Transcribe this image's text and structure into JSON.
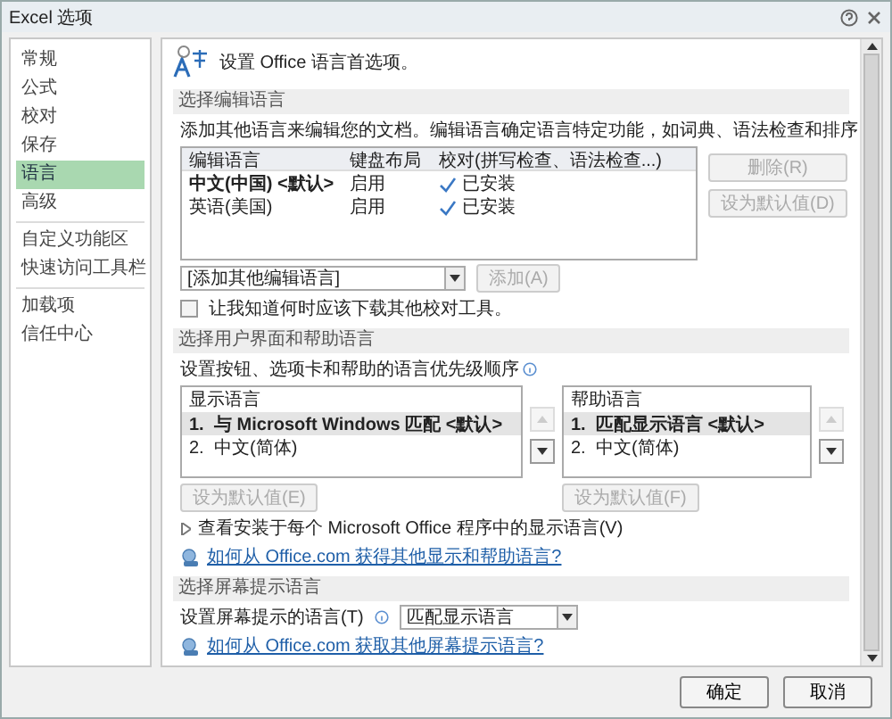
{
  "window": {
    "title": "Excel 选项"
  },
  "sidebar": {
    "groups": [
      [
        {
          "label": "常规",
          "selected": false
        },
        {
          "label": "公式",
          "selected": false
        },
        {
          "label": "校对",
          "selected": false
        },
        {
          "label": "保存",
          "selected": false
        },
        {
          "label": "语言",
          "selected": true
        },
        {
          "label": "高级",
          "selected": false
        }
      ],
      [
        {
          "label": "自定义功能区",
          "selected": false
        },
        {
          "label": "快速访问工具栏",
          "selected": false
        }
      ],
      [
        {
          "label": "加载项",
          "selected": false
        },
        {
          "label": "信任中心",
          "selected": false
        }
      ]
    ]
  },
  "header": "设置 Office 语言首选项。",
  "editing": {
    "title": "选择编辑语言",
    "description": "添加其他语言来编辑您的文档。编辑语言确定语言特定功能，如词典、语法检查和排序",
    "columns": [
      "编辑语言",
      "键盘布局",
      "校对(拼写检查、语法检查...)"
    ],
    "rows": [
      {
        "language": "中文(中国) <默认>",
        "keyboard": "启用",
        "proofing": "已安装",
        "is_default": true
      },
      {
        "language": "英语(美国)",
        "keyboard": "启用",
        "proofing": "已安装",
        "is_default": false
      }
    ],
    "side_buttons": [
      {
        "label": "删除(R)",
        "disabled": true
      },
      {
        "label": "设为默认值(D)",
        "disabled": true
      }
    ],
    "add_dropdown": "[添加其他编辑语言]",
    "add_button": {
      "label": "添加(A)",
      "disabled": true
    },
    "checkbox": {
      "label": "让我知道何时应该下载其他校对工具。",
      "checked": false
    }
  },
  "ui": {
    "title": "选择用户界面和帮助语言",
    "description": "设置按钮、选项卡和帮助的语言优先级顺序",
    "lists": [
      {
        "heading": "显示语言",
        "items": [
          {
            "number": "1.",
            "name": "与 Microsoft Windows 匹配 <默认>",
            "selected": true
          },
          {
            "number": "2.",
            "name": "中文(简体)",
            "selected": false
          }
        ],
        "up_disabled": true,
        "down_disabled": false,
        "default_button": {
          "label": "设为默认值(E)",
          "disabled": true
        }
      },
      {
        "heading": "帮助语言",
        "items": [
          {
            "number": "1.",
            "name": "匹配显示语言 <默认>",
            "selected": true
          },
          {
            "number": "2.",
            "name": "中文(简体)",
            "selected": false
          }
        ],
        "up_disabled": true,
        "down_disabled": false,
        "default_button": {
          "label": "设为默认值(F)",
          "disabled": true
        }
      }
    ],
    "expander": {
      "label": "查看安装于每个 Microsoft Office 程序中的显示语言(V)",
      "expanded": false
    },
    "link": "如何从 Office.com 获得其他显示和帮助语言?"
  },
  "screentip": {
    "title": "选择屏幕提示语言",
    "label": "设置屏幕提示的语言(T)",
    "dropdown": "匹配显示语言",
    "link": "如何从 Office.com 获取其他屏幕提示语言?"
  },
  "footer": {
    "buttons": [
      "确定",
      "取消"
    ]
  }
}
